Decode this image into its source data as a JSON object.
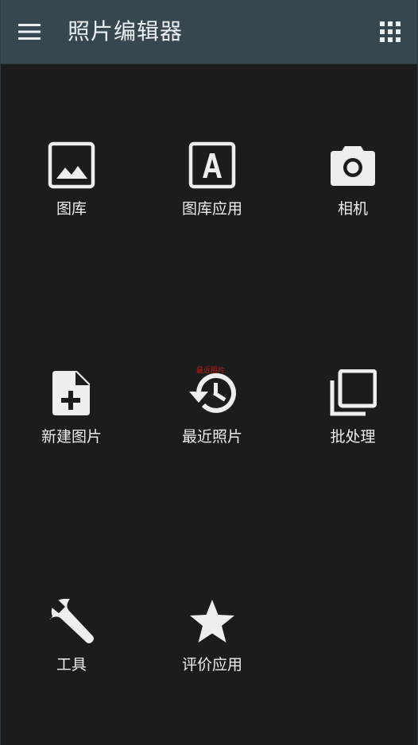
{
  "app": {
    "title": "照片编辑器"
  },
  "icons": {
    "menu": "hamburger-menu-icon",
    "apps": "apps-grid-icon"
  },
  "colors": {
    "appbar": "#37474f",
    "background": "#1c1c1c",
    "icon": "#eeeeee",
    "text": "#eeeeee",
    "badge": "#b71c1c"
  },
  "grid": [
    {
      "label": "图库",
      "icon": "image-icon"
    },
    {
      "label": "图库应用",
      "icon": "font-download-icon"
    },
    {
      "label": "相机",
      "icon": "camera-icon"
    },
    {
      "label": "新建图片",
      "icon": "note-add-icon"
    },
    {
      "label": "最近照片",
      "icon": "history-icon"
    },
    {
      "label": "批处理",
      "icon": "library-icon"
    },
    {
      "label": "工具",
      "icon": "wrench-icon"
    },
    {
      "label": "评价应用",
      "icon": "star-icon"
    }
  ],
  "badge": {
    "text": "最近照片"
  }
}
